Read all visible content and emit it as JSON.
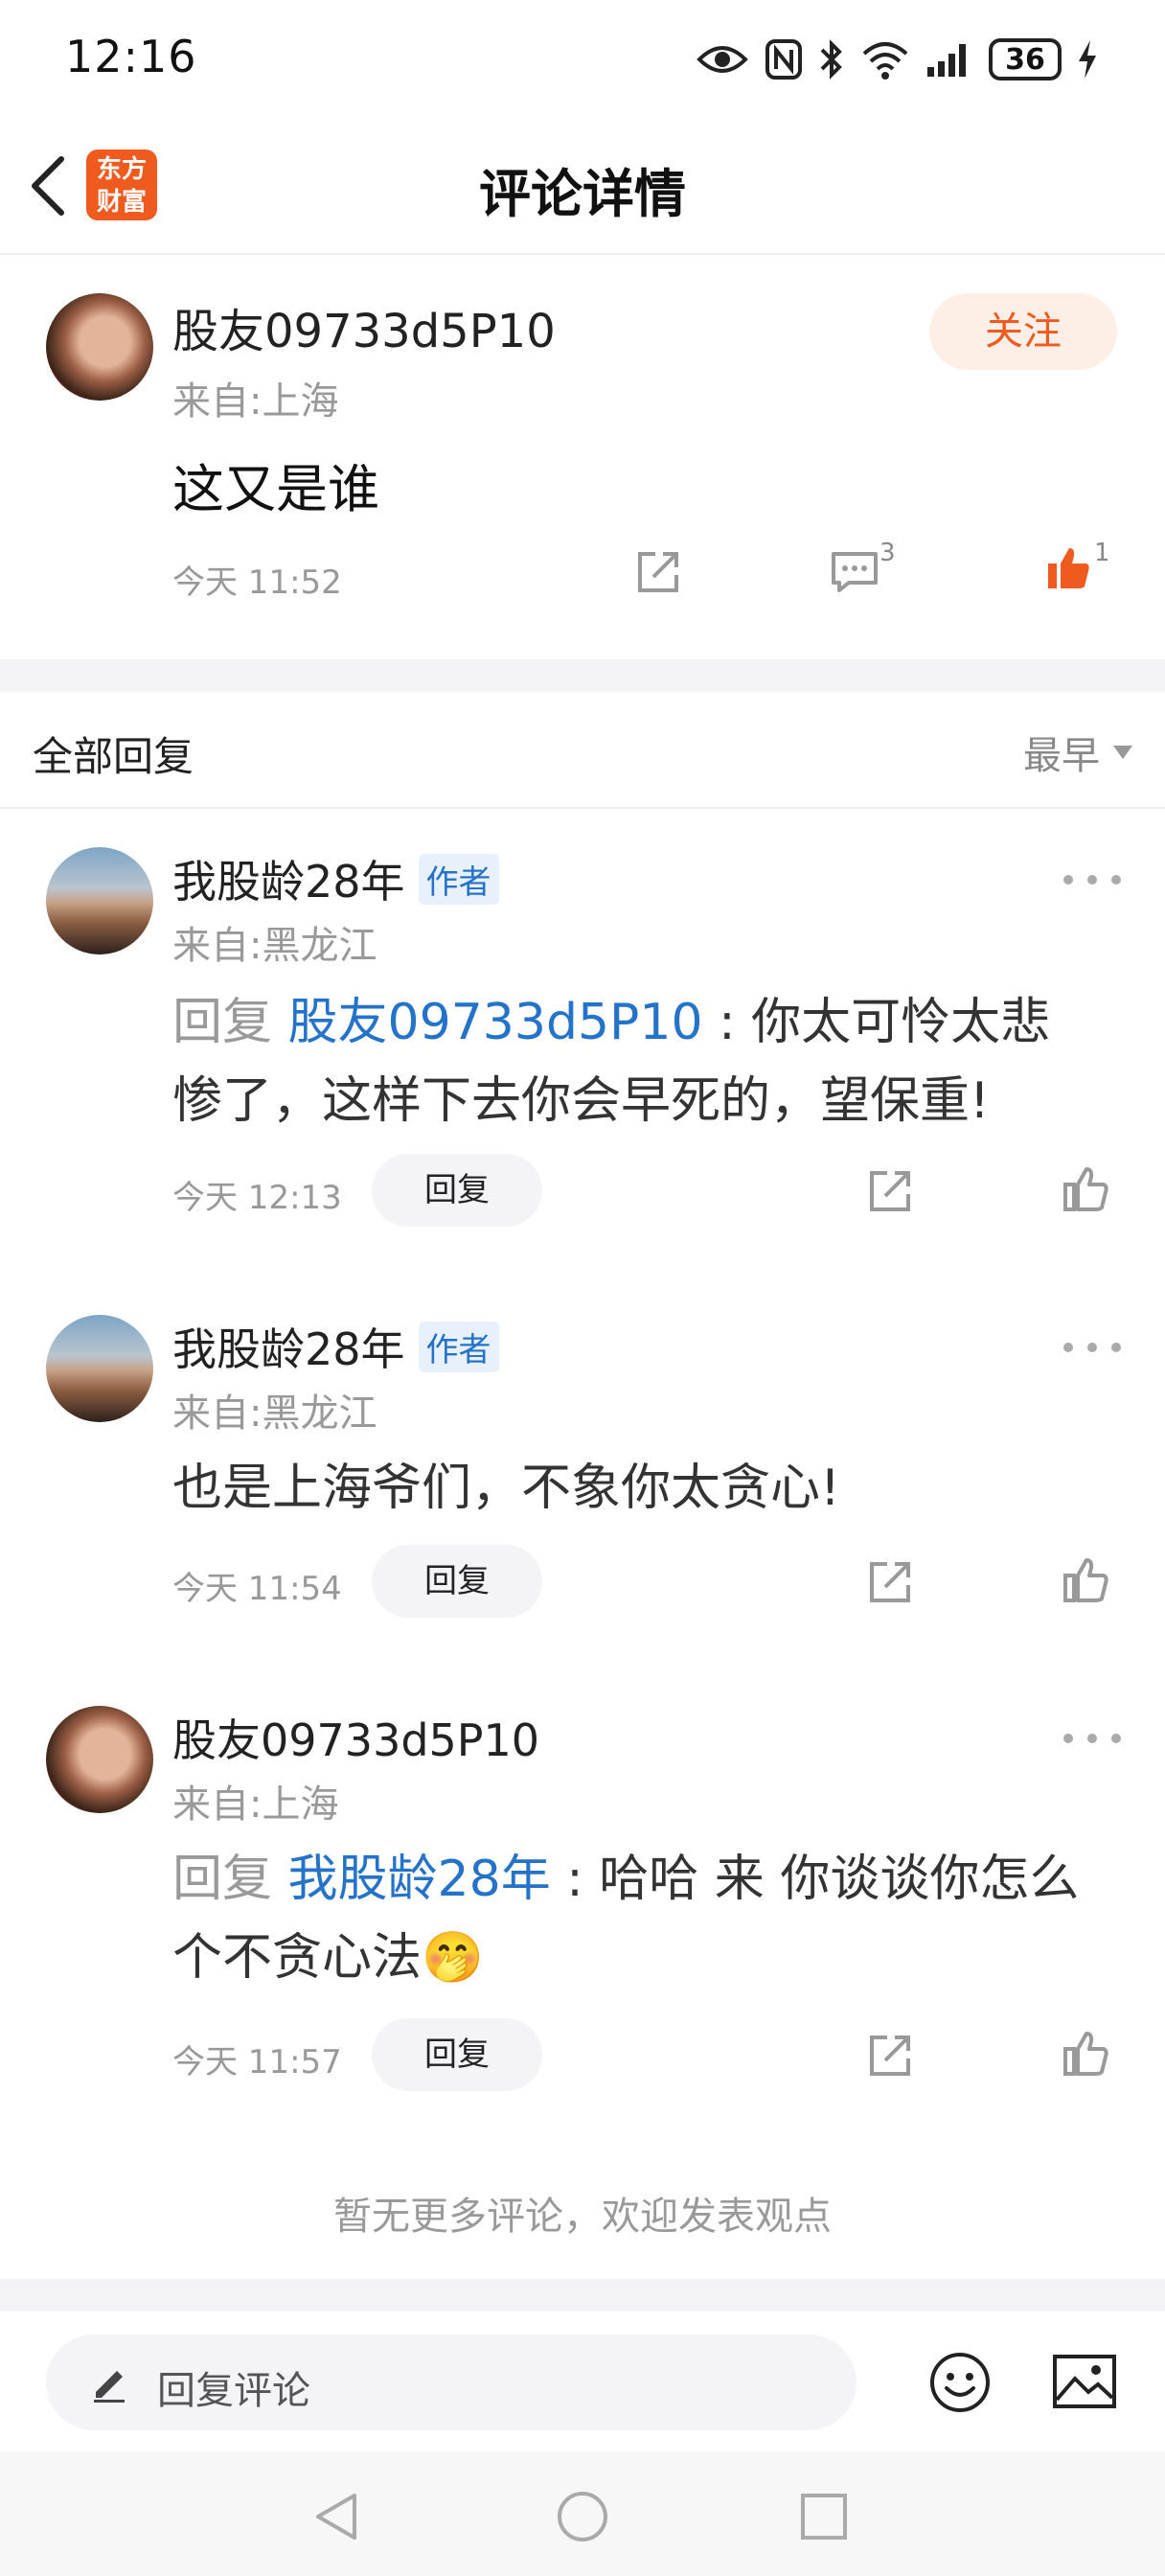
{
  "status_bar": {
    "time": "12:16",
    "battery": "36"
  },
  "header": {
    "logo_text": "东方财富",
    "title": "评论详情"
  },
  "post": {
    "username": "股友09733d5P10",
    "location": "来自:上海",
    "text": "这又是谁",
    "time": "今天 11:52",
    "follow_label": "关注",
    "comment_count": "3",
    "like_count": "1"
  },
  "replies_section": {
    "title": "全部回复",
    "sort_label": "最早"
  },
  "replies": [
    {
      "username": "我股龄28年",
      "badge": "作者",
      "location": "来自:黑龙江",
      "prefix": "回复 ",
      "mention": "股友09733d5P10",
      "text": " : 你太可怜太悲惨了，这样下去你会早死的，望保重!",
      "time": "今天 12:13",
      "reply_label": "回复"
    },
    {
      "username": "我股龄28年",
      "badge": "作者",
      "location": "来自:黑龙江",
      "prefix": "",
      "mention": "",
      "text": "也是上海爷们，不象你太贪心!",
      "time": "今天 11:54",
      "reply_label": "回复"
    },
    {
      "username": "股友09733d5P10",
      "badge": "",
      "location": "来自:上海",
      "prefix": "回复 ",
      "mention": "我股龄28年",
      "text": " : 哈哈 来 你谈谈你怎么个不贪心法🤭",
      "time": "今天 11:57",
      "reply_label": "回复"
    }
  ],
  "end_note": "暂无更多评论，欢迎发表观点",
  "input_bar": {
    "placeholder": "回复评论"
  },
  "colors": {
    "accent": "#ef5a1f",
    "link": "#2573c9",
    "muted": "#999999"
  }
}
